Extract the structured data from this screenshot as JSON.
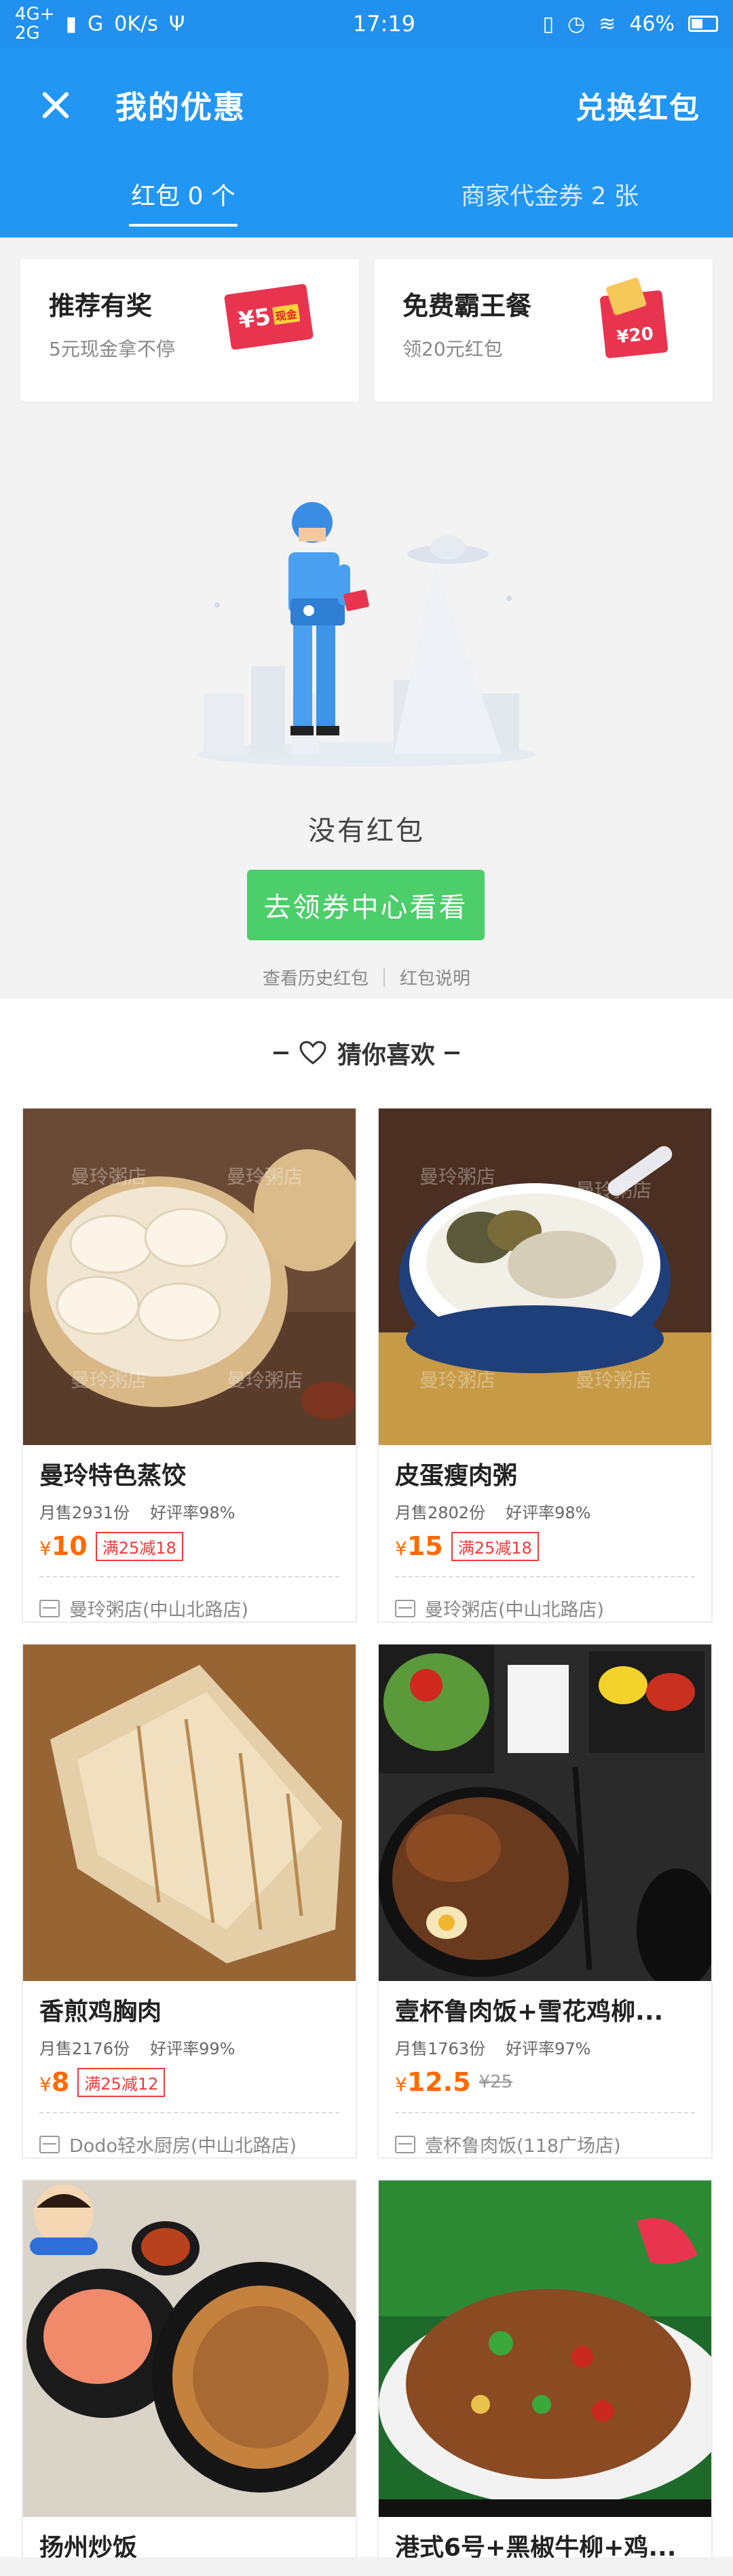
{
  "status_bar": {
    "network_top": "4G+",
    "network_bottom": "2G",
    "signal2": "G",
    "speed": "0K/s",
    "time": "17:19",
    "battery": "46%"
  },
  "header": {
    "title": "我的优惠",
    "exchange_label": "兑换红包"
  },
  "tabs": [
    {
      "label": "红包 0 个",
      "active": true
    },
    {
      "label": "商家代金券 2 张",
      "active": false
    }
  ],
  "promos": [
    {
      "title": "推荐有奖",
      "subtitle": "5元现金拿不停",
      "art_text": "¥5",
      "art_tag": "现金"
    },
    {
      "title": "免费霸王餐",
      "subtitle": "领20元红包",
      "art_text": "¥20"
    }
  ],
  "empty_state": {
    "message": "没有红包",
    "button_label": "去领券中心看看",
    "link_history": "查看历史红包",
    "link_explain": "红包说明"
  },
  "recommend": {
    "heading": "猜你喜欢",
    "items": [
      {
        "title": "曼玲特色蒸饺",
        "sales": "月售2931份",
        "rating": "好评率98%",
        "currency": "¥",
        "price": "10",
        "badge": "满25减18",
        "original_price": "",
        "shop": "曼玲粥店(中山北路店)"
      },
      {
        "title": "皮蛋瘦肉粥",
        "sales": "月售2802份",
        "rating": "好评率98%",
        "currency": "¥",
        "price": "15",
        "badge": "满25减18",
        "original_price": "",
        "shop": "曼玲粥店(中山北路店)"
      },
      {
        "title": "香煎鸡胸肉",
        "sales": "月售2176份",
        "rating": "好评率99%",
        "currency": "¥",
        "price": "8",
        "badge": "满25减12",
        "original_price": "",
        "shop": "Dodo轻水厨房(中山北路店)"
      },
      {
        "title": "壹杯鲁肉饭+雪花鸡柳...",
        "sales": "月售1763份",
        "rating": "好评率97%",
        "currency": "¥",
        "price": "12.5",
        "badge": "",
        "original_price": "¥25",
        "shop": "壹杯鲁肉饭(118广场店)"
      },
      {
        "title": "扬州炒饭",
        "sales": "",
        "rating": "",
        "currency": "",
        "price": "",
        "badge": "",
        "original_price": "",
        "shop": ""
      },
      {
        "title": "港式6号+黑椒牛柳+鸡...",
        "sales": "",
        "rating": "",
        "currency": "",
        "price": "",
        "badge": "",
        "original_price": "",
        "shop": ""
      }
    ]
  },
  "watermark": "曼玲粥店",
  "colors": {
    "primary_blue": "#2196f3",
    "green_button": "#4cce6a",
    "price_orange": "#ff6a00",
    "badge_red": "#f03a3a"
  }
}
